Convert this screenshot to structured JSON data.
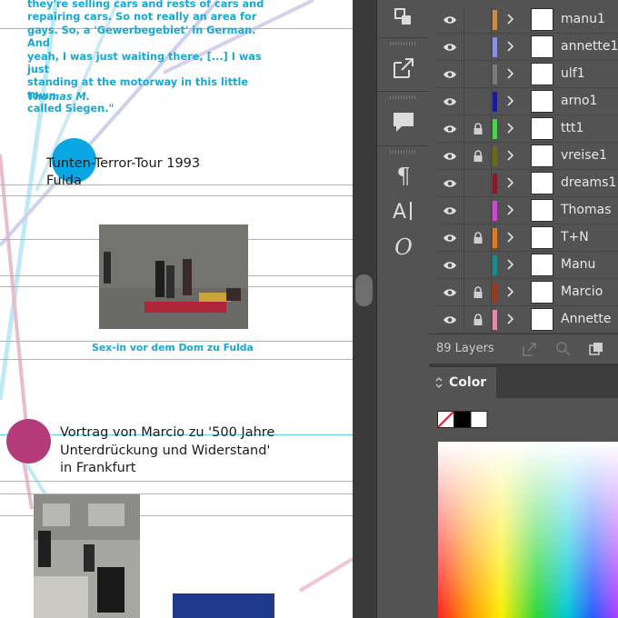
{
  "document": {
    "quote_text": "they're selling cars and rests of cars and\nrepairing cars. So not really an area for\ngays. So, a 'Gewerbegebiet' in German. And\nyeah, I was just waiting there, [...] I was just\nstanding at the motorway in this little town\ncalled Siegen.\"",
    "quote_author": "Thomas M.",
    "event1_title": "Tunten-Terror-Tour 1993\nFulda",
    "photo1_caption": "Sex-in vor dem Dom zu Fulda",
    "event2_title": "Vortrag von Marcio zu '500 Jahre\nUnterdrückung und Widerstand'\nin Frankfurt",
    "accent_blue": "#0aa7e4",
    "accent_magenta": "#b33b7a",
    "guide_color": "#5fd1e8"
  },
  "toolstrip": {
    "tools": [
      {
        "icon": "arrange-pages-icon"
      },
      {
        "icon": "export-icon"
      },
      {
        "icon": "comment-icon"
      },
      {
        "icon": "paragraph-icon"
      },
      {
        "icon": "character-icon"
      },
      {
        "icon": "glyphs-icon"
      }
    ]
  },
  "layers_panel": {
    "layers": [
      {
        "name": "manu1",
        "color": "#c98a4a",
        "visible": true,
        "locked": false
      },
      {
        "name": "annette1",
        "color": "#8a8ee0",
        "visible": true,
        "locked": false
      },
      {
        "name": "ulf1",
        "color": "#7a7a7a",
        "visible": true,
        "locked": false
      },
      {
        "name": "arno1",
        "color": "#1a1a9a",
        "visible": true,
        "locked": false
      },
      {
        "name": "ttt1",
        "color": "#4ad04a",
        "visible": true,
        "locked": true
      },
      {
        "name": "vreise1",
        "color": "#6a6a18",
        "visible": true,
        "locked": true
      },
      {
        "name": "dreams1",
        "color": "#8a1a2a",
        "visible": true,
        "locked": false
      },
      {
        "name": "Thomas",
        "color": "#c84ad0",
        "visible": true,
        "locked": false
      },
      {
        "name": "T+N",
        "color": "#e07a20",
        "visible": true,
        "locked": true
      },
      {
        "name": "Manu",
        "color": "#1a8a8a",
        "visible": true,
        "locked": false
      },
      {
        "name": "Marcio",
        "color": "#9a3a1a",
        "visible": true,
        "locked": true
      },
      {
        "name": "Annette",
        "color": "#e08ab0",
        "visible": true,
        "locked": true
      }
    ],
    "layer_count": "89 Layers"
  },
  "color_panel": {
    "tab_label": "Color",
    "fill_color": "#000000",
    "stroke_color": "#ffffff"
  }
}
